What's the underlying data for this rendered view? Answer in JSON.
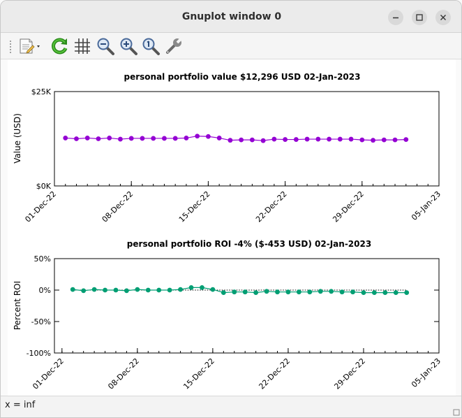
{
  "window": {
    "title": "Gnuplot window 0"
  },
  "toolbar": {
    "icons": [
      "export-icon",
      "dropdown-arrow-icon",
      "replot-icon",
      "grid-icon",
      "zoom-out-icon",
      "zoom-in-icon",
      "zoom-autoscale-icon",
      "settings-icon"
    ]
  },
  "status": {
    "text": "x = inf"
  },
  "colors": {
    "value_series": "#9400d3",
    "roi_series": "#009e73",
    "reference_line": "#000000"
  },
  "chart_data": [
    {
      "type": "line",
      "title": "personal portfolio value $12,296 USD 02-Jan-2023",
      "ylabel": "Value (USD)",
      "xlabel": "",
      "ytick_labels": [
        "$25K",
        "$0K"
      ],
      "xtick_labels": [
        "01-Dec-22",
        "08-Dec-22",
        "15-Dec-22",
        "22-Dec-22",
        "29-Dec-22",
        "05-Jan-23"
      ],
      "x_range": [
        "01-Dec-22",
        "05-Jan-23"
      ],
      "ylim": [
        0,
        25000
      ],
      "grid": false,
      "x": [
        "02-Dec-22",
        "03-Dec-22",
        "04-Dec-22",
        "05-Dec-22",
        "06-Dec-22",
        "07-Dec-22",
        "08-Dec-22",
        "09-Dec-22",
        "10-Dec-22",
        "11-Dec-22",
        "12-Dec-22",
        "13-Dec-22",
        "14-Dec-22",
        "15-Dec-22",
        "16-Dec-22",
        "17-Dec-22",
        "18-Dec-22",
        "19-Dec-22",
        "20-Dec-22",
        "21-Dec-22",
        "22-Dec-22",
        "23-Dec-22",
        "24-Dec-22",
        "25-Dec-22",
        "26-Dec-22",
        "27-Dec-22",
        "28-Dec-22",
        "29-Dec-22",
        "30-Dec-22",
        "31-Dec-22",
        "01-Jan-23",
        "02-Jan-23"
      ],
      "series": [
        {
          "values": [
            12700,
            12500,
            12700,
            12500,
            12700,
            12400,
            12600,
            12600,
            12600,
            12600,
            12600,
            12700,
            13200,
            13100,
            12700,
            12100,
            12200,
            12200,
            12000,
            12400,
            12300,
            12300,
            12400,
            12400,
            12400,
            12400,
            12400,
            12200,
            12100,
            12200,
            12200,
            12296
          ]
        }
      ]
    },
    {
      "type": "line",
      "title": "personal portfolio ROI -4% ($-453 USD) 02-Jan-2023",
      "ylabel": "Percent ROI",
      "xlabel": "",
      "ytick_labels": [
        "50%",
        "0%",
        "-50%",
        "-100%"
      ],
      "xtick_labels": [
        "01-Dec-22",
        "08-Dec-22",
        "15-Dec-22",
        "22-Dec-22",
        "29-Dec-22",
        "05-Jan-23"
      ],
      "x_range": [
        "01-Dec-22",
        "05-Jan-23"
      ],
      "ylim": [
        -100,
        50
      ],
      "grid": false,
      "reference_line": 0,
      "x": [
        "02-Dec-22",
        "03-Dec-22",
        "04-Dec-22",
        "05-Dec-22",
        "06-Dec-22",
        "07-Dec-22",
        "08-Dec-22",
        "09-Dec-22",
        "10-Dec-22",
        "11-Dec-22",
        "12-Dec-22",
        "13-Dec-22",
        "14-Dec-22",
        "15-Dec-22",
        "16-Dec-22",
        "17-Dec-22",
        "18-Dec-22",
        "19-Dec-22",
        "20-Dec-22",
        "21-Dec-22",
        "22-Dec-22",
        "23-Dec-22",
        "24-Dec-22",
        "25-Dec-22",
        "26-Dec-22",
        "27-Dec-22",
        "28-Dec-22",
        "29-Dec-22",
        "30-Dec-22",
        "31-Dec-22",
        "01-Jan-23",
        "02-Jan-23"
      ],
      "series": [
        {
          "values": [
            1,
            -1,
            1,
            0,
            0,
            -1,
            1,
            0,
            0,
            0,
            1,
            4,
            4,
            1,
            -4,
            -3,
            -3,
            -4,
            -2,
            -3,
            -3,
            -3,
            -3,
            -2,
            -2,
            -3,
            -3,
            -4,
            -4,
            -4,
            -4,
            -4
          ]
        }
      ]
    }
  ]
}
